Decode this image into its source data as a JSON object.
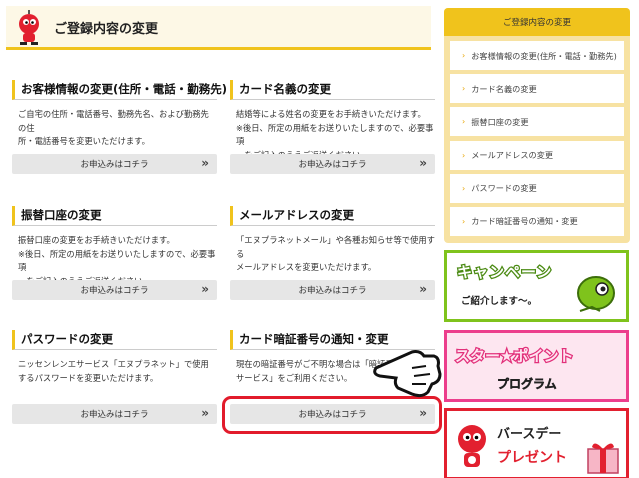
{
  "header": {
    "title": "ご登録内容の変更"
  },
  "cards": [
    {
      "title": "お客様情報の変更(住所・電話・勤務先)",
      "desc": "ご自宅の住所・電話番号、勤務先名、および勤務先の住\n所・電話番号を変更いただけます。",
      "button": "お申込みはコチラ"
    },
    {
      "title": "カード名義の変更",
      "desc": "結婚等による姓名の変更をお手続きいただけます。\n※後日、所定の用紙をお送りいたしますので、必要事項\n　をご記入のうえご返送ください。",
      "button": "お申込みはコチラ"
    },
    {
      "title": "振替口座の変更",
      "desc": "振替口座の変更をお手続きいただけます。\n※後日、所定の用紙をお送りいたしますので、必要事項\n　をご記入のうえご返送ください。",
      "button": "お申込みはコチラ"
    },
    {
      "title": "メールアドレスの変更",
      "desc": "「エヌプラネットメール」や各種お知らせ等で使用する\nメールアドレスを変更いただけます。",
      "button": "お申込みはコチラ"
    },
    {
      "title": "パスワードの変更",
      "desc": "ニッセンレンエサービス「エヌプラネット」で使用\nするパスワードを変更いただけます。",
      "button": "お申込みはコチラ"
    },
    {
      "title": "カード暗証番号の通知・変更",
      "desc": "現在の暗証番号がご不明な場合は「暗証番\nサービス」をご利用ください。",
      "button": "お申込みはコチラ"
    }
  ],
  "sidebar": {
    "title": "ご登録内容の変更",
    "items": [
      "お客様情報の変更(住所・電話・勤務先)",
      "カード名義の変更",
      "振替口座の変更",
      "メールアドレスの変更",
      "パスワードの変更",
      "カード暗証番号の通知・変更"
    ]
  },
  "banners": {
    "campaign": {
      "title": "キャンペーン",
      "sub": "ご紹介します〜。"
    },
    "star": {
      "title": "スター★ポイント",
      "sub": "プログラム"
    },
    "birthday": {
      "title": "バースデー",
      "sub": "プレゼント"
    }
  },
  "colors": {
    "accent": "#f0c31c",
    "highlight": "#e21b2b",
    "campaign": "#7fc31c",
    "star": "#ec3e8c"
  },
  "icons": {
    "button_arrow": "double-chevron-right-icon",
    "menu_chevron": "chevron-right-icon",
    "mascot": "mascot-icon",
    "pointer": "pointing-hand-icon"
  }
}
